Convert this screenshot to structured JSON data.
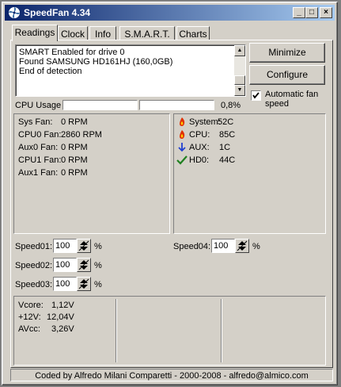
{
  "window": {
    "title": "SpeedFan 4.34"
  },
  "titlebar_buttons": {
    "minimize": "_",
    "maximize": "□",
    "close": "×"
  },
  "tabs": [
    {
      "label": "Readings",
      "active": true
    },
    {
      "label": "Clock"
    },
    {
      "label": "Info"
    },
    {
      "label": "S.M.A.R.T."
    },
    {
      "label": "Charts"
    }
  ],
  "log": {
    "lines": [
      "SMART Enabled for drive 0",
      "Found SAMSUNG HD161HJ (160,0GB)",
      "End of detection"
    ]
  },
  "buttons": {
    "minimize": "Minimize",
    "configure": "Configure"
  },
  "auto_fan": {
    "label": "Automatic fan speed",
    "checked": true
  },
  "cpu_usage": {
    "label": "CPU Usage",
    "value": "0,8%",
    "bar1_fraction": 0.0,
    "bar2_fraction": 0.0
  },
  "fans": [
    {
      "label": "Sys Fan:",
      "value": "0 RPM"
    },
    {
      "label": "CPU0 Fan:",
      "value": "2860 RPM"
    },
    {
      "label": "Aux0 Fan:",
      "value": "0 RPM"
    },
    {
      "label": "CPU1 Fan:",
      "value": "0 RPM"
    },
    {
      "label": "Aux1 Fan:",
      "value": "0 RPM"
    }
  ],
  "temps": [
    {
      "label": "System:",
      "value": "52C",
      "icon": "flame-icon"
    },
    {
      "label": "CPU:",
      "value": "85C",
      "icon": "flame-icon"
    },
    {
      "label": "AUX:",
      "value": "1C",
      "icon": "down-arrow-icon"
    },
    {
      "label": "HD0:",
      "value": "44C",
      "icon": "check-icon"
    }
  ],
  "speeds": [
    {
      "label": "Speed01:",
      "value": "100",
      "unit": "%"
    },
    {
      "label": "Speed02:",
      "value": "100",
      "unit": "%"
    },
    {
      "label": "Speed03:",
      "value": "100",
      "unit": "%"
    },
    {
      "label": "Speed04:",
      "value": "100",
      "unit": "%"
    }
  ],
  "voltages": [
    {
      "label": "Vcore:",
      "value": "1,12V"
    },
    {
      "label": "+12V:",
      "value": "12,04V"
    },
    {
      "label": "AVcc:",
      "value": "3,26V"
    }
  ],
  "footer": {
    "text": "Coded by Alfredo Milani Comparetti - 2000-2008 - alfredo@almico.com"
  },
  "colors": {
    "title_start": "#0a246a",
    "title_end": "#a6caf0",
    "flame": "#e03000",
    "arrow": "#2040d0",
    "check": "#208020"
  }
}
